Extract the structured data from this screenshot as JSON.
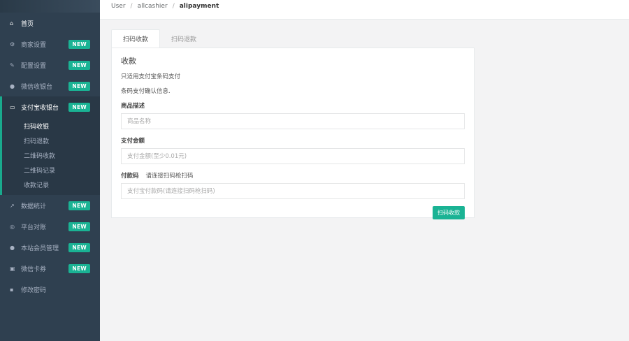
{
  "sidebar": {
    "items": [
      {
        "icon": "⌂",
        "icon_name": "home-icon",
        "label": "首页",
        "badge": ""
      },
      {
        "icon": "⚙",
        "icon_name": "gears-icon",
        "label": "商家设置",
        "badge": "NEW"
      },
      {
        "icon": "✎",
        "icon_name": "wrench-icon",
        "label": "配置设置",
        "badge": "NEW"
      },
      {
        "icon": "●",
        "icon_name": "wechat-icon",
        "label": "微信收银台",
        "badge": "NEW"
      },
      {
        "icon": "▭",
        "icon_name": "laptop-icon",
        "label": "支付宝收银台",
        "badge": "NEW"
      },
      {
        "icon": "↗",
        "icon_name": "line-chart-icon",
        "label": "数据统计",
        "badge": "NEW"
      },
      {
        "icon": "◎",
        "icon_name": "globe-icon",
        "label": "平台对账",
        "badge": "NEW"
      },
      {
        "icon": "●",
        "icon_name": "user-icon",
        "label": "本站会员管理",
        "badge": "NEW"
      },
      {
        "icon": "▣",
        "icon_name": "ticket-icon",
        "label": "微信卡券",
        "badge": "NEW"
      },
      {
        "icon": "▪",
        "icon_name": "lock-icon",
        "label": "修改密码",
        "badge": ""
      }
    ],
    "submenu": [
      "扫码收银",
      "扫码退款",
      "二维码收款",
      "二维码记录",
      "收款记录"
    ]
  },
  "breadcrumb": {
    "c1": "User",
    "c2": "allcashier",
    "c3": "alipayment",
    "sep": "/"
  },
  "tabs": [
    "扫码收款",
    "扫码退款"
  ],
  "panel": {
    "title": "收款",
    "hint1": "只适用支付宝条码支付",
    "hint2": "条码支付确认信息.",
    "field1_label": "商品描述",
    "field1_placeholder": "商品名称",
    "field2_label": "支付金额",
    "field2_placeholder": "支付金额(至少0.01元)",
    "field3_label": "付款码",
    "field3_extra": "请连接扫码枪扫码",
    "field3_placeholder": "支付宝付款码(请连接扫码枪扫码)",
    "submit_label": "扫码收款"
  },
  "colors": {
    "sidebar_bg": "#2f4050",
    "accent": "#1ab394"
  }
}
